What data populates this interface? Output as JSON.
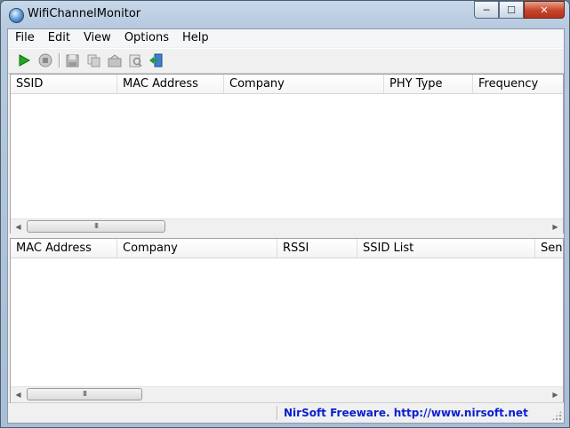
{
  "window": {
    "title": "WifiChannelMonitor",
    "buttons": {
      "minimize": "─",
      "maximize": "☐",
      "close": "✕"
    }
  },
  "menu": [
    "File",
    "Edit",
    "View",
    "Options",
    "Help"
  ],
  "toolbar": {
    "icons": [
      "play-icon",
      "stop-icon",
      "save-icon",
      "copy-icon",
      "html-report-icon",
      "properties-icon",
      "exit-icon"
    ]
  },
  "top_table": {
    "columns": [
      "SSID",
      "MAC Address",
      "Company",
      "PHY Type",
      "Frequency"
    ],
    "rows": []
  },
  "bottom_table": {
    "columns": [
      "MAC Address",
      "Company",
      "RSSI",
      "SSID List",
      "Sent"
    ],
    "rows": []
  },
  "scrollbar": {
    "arrow_left": "◀",
    "arrow_right": "▶",
    "grip": "III"
  },
  "status": {
    "text": "NirSoft Freeware.  http://www.nirsoft.net"
  },
  "colors": {
    "status_link": "#0a1ed0",
    "play_green": "#1faa1f",
    "close_red": "#c8442a"
  }
}
